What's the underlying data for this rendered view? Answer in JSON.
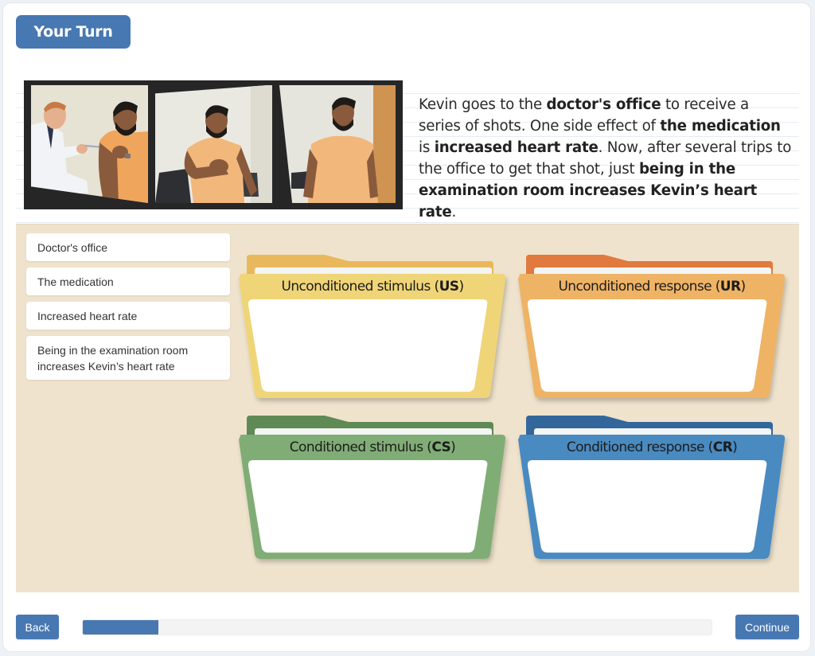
{
  "header": {
    "badge_label": "Your Turn"
  },
  "scenario": {
    "image_alt": "Three-panel photo strip: a doctor gives Kevin a shot; Kevin holds his chest; Kevin standing in the examination room",
    "paragraph_segments": [
      {
        "text": "Kevin goes to the ",
        "bold": false
      },
      {
        "text": "doctor's office",
        "bold": true
      },
      {
        "text": " to receive a series of shots. One side effect of ",
        "bold": false
      },
      {
        "text": "the medication",
        "bold": true
      },
      {
        "text": " is ",
        "bold": false
      },
      {
        "text": "increased heart rate",
        "bold": true
      },
      {
        "text": ". Now, after several trips to the office to get that shot, just ",
        "bold": false
      },
      {
        "text": "being in the examination room increases Kevin’s heart rate",
        "bold": true
      },
      {
        "text": ".",
        "bold": false
      }
    ]
  },
  "drag_items": [
    {
      "label": "Doctor's office"
    },
    {
      "label": "The medication"
    },
    {
      "label": "Increased heart rate"
    },
    {
      "label": "Being in the examination room increases Kevin’s heart rate"
    }
  ],
  "folders": [
    {
      "label": "Unconditioned stimulus",
      "abbr": "US",
      "back_color": "#eab85c",
      "front_color": "#efd577"
    },
    {
      "label": "Unconditioned response",
      "abbr": "UR",
      "back_color": "#e07a3e",
      "front_color": "#efb365"
    },
    {
      "label": "Conditioned stimulus",
      "abbr": "CS",
      "back_color": "#5f8a55",
      "front_color": "#80ad74"
    },
    {
      "label": "Conditioned response",
      "abbr": "CR",
      "back_color": "#33679b",
      "front_color": "#4a8ac1"
    }
  ],
  "footer": {
    "back_label": "Back",
    "continue_label": "Continue",
    "progress_percent": 12
  },
  "colors": {
    "accent": "#4778b2",
    "activity_background": "#efe3cd"
  }
}
